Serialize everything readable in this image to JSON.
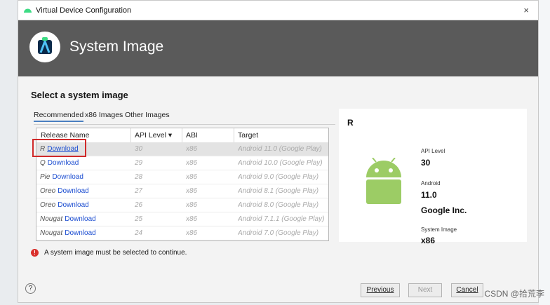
{
  "window": {
    "title": "Virtual Device Configuration",
    "close": "×"
  },
  "banner": {
    "title": "System Image"
  },
  "heading": "Select a system image",
  "tabs": [
    {
      "label": "Recommended",
      "active": true
    },
    {
      "label": "x86 Images",
      "active": false
    },
    {
      "label": "Other Images",
      "active": false
    }
  ],
  "table": {
    "headers": [
      "Release Name",
      "API Level ▾",
      "ABI",
      "Target"
    ],
    "rows": [
      {
        "name": "R",
        "action": "Download",
        "api": "30",
        "abi": "x86",
        "target": "Android 11.0 (Google Play)",
        "selected": true
      },
      {
        "name": "Q",
        "action": "Download",
        "api": "29",
        "abi": "x86",
        "target": "Android 10.0 (Google Play)",
        "selected": false
      },
      {
        "name": "Pie",
        "action": "Download",
        "api": "28",
        "abi": "x86",
        "target": "Android 9.0 (Google Play)",
        "selected": false
      },
      {
        "name": "Oreo",
        "action": "Download",
        "api": "27",
        "abi": "x86",
        "target": "Android 8.1 (Google Play)",
        "selected": false
      },
      {
        "name": "Oreo",
        "action": "Download",
        "api": "26",
        "abi": "x86",
        "target": "Android 8.0 (Google Play)",
        "selected": false
      },
      {
        "name": "Nougat",
        "action": "Download",
        "api": "25",
        "abi": "x86",
        "target": "Android 7.1.1 (Google Play)",
        "selected": false
      },
      {
        "name": "Nougat",
        "action": "Download",
        "api": "24",
        "abi": "x86",
        "target": "Android 7.0 (Google Play)",
        "selected": false
      }
    ]
  },
  "error": {
    "icon": "error-icon",
    "text": "A system image must be selected to continue."
  },
  "details": {
    "title": "R",
    "api_label": "API Level",
    "api_value": "30",
    "android_label": "Android",
    "android_value": "11.0",
    "vendor": "Google Inc.",
    "system_image_label": "System Image",
    "system_image_value": "x86"
  },
  "buttons": {
    "help": "?",
    "previous": "Previous",
    "next": "Next",
    "cancel": "Cancel"
  },
  "watermark": "CSDN @拾荒李",
  "colors": {
    "banner": "#5a5a5a",
    "link": "#1e4fd1",
    "android_green": "#9ccc65",
    "error": "#d9302c",
    "highlight_box": "#d02a2a"
  }
}
